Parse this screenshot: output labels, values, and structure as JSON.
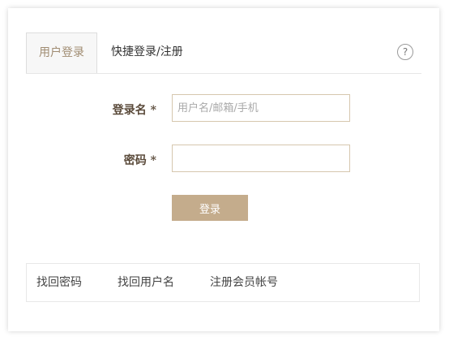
{
  "tabs": {
    "account_login": "用户登录",
    "quick_login": "快捷登录/注册",
    "help": "?"
  },
  "form": {
    "username_label": "登录名 *",
    "username_placeholder": "用户名/邮箱/手机",
    "username_value": "",
    "password_label": "密码 *",
    "password_value": "",
    "submit_label": "登录"
  },
  "footer_links": {
    "forgot_password": "找回密码",
    "forgot_username": "找回用户名",
    "register": "注册会员帐号"
  },
  "colors": {
    "accent": "#c4ac8c",
    "active_tab_text": "#a08c72",
    "input_border": "#d6c7ae"
  }
}
